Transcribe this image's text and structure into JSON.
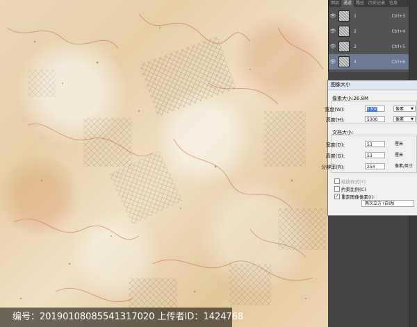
{
  "channels_panel": {
    "tabs": [
      "图层",
      "通道",
      "路径",
      "历史记录",
      "信息"
    ],
    "active_tab": 1,
    "channels": [
      {
        "name": "1",
        "shortcut": "Ctrl+3"
      },
      {
        "name": "2",
        "shortcut": "Ctrl+4"
      },
      {
        "name": "3",
        "shortcut": "Ctrl+5"
      },
      {
        "name": "4",
        "shortcut": "Ctrl+6"
      }
    ],
    "selected_index": 3
  },
  "image_size_dialog": {
    "title": "图像大小",
    "pixel_dimensions_label": "像素大小:26.8M",
    "width_label": "宽度(W):",
    "width_value": "5300",
    "width_unit": "像素",
    "height_label": "高度(H):",
    "height_value": "5300",
    "height_unit": "像素",
    "doc_size_label": "文档大小:",
    "doc_width_label": "宽度(D):",
    "doc_width_value": "53",
    "doc_width_unit": "厘米",
    "doc_height_label": "高度(G):",
    "doc_height_value": "53",
    "doc_height_unit": "厘米",
    "resolution_label": "分辨率(R):",
    "resolution_value": "254",
    "resolution_unit": "像素/英寸",
    "scale_styles_label": "缩放样式(Y)",
    "constrain_label": "约束比例(C)",
    "resample_label": "重定图像像素(I):",
    "resample_method": "两次立方 (自动)"
  },
  "watermark": "编号：20190108085541317020 上传者ID：1424768",
  "colors": {
    "panel_bg": "#535353",
    "selected_row": "#6c7a95",
    "dialog_bg": "#f0f0f0",
    "selection": "#3a6fd8"
  }
}
